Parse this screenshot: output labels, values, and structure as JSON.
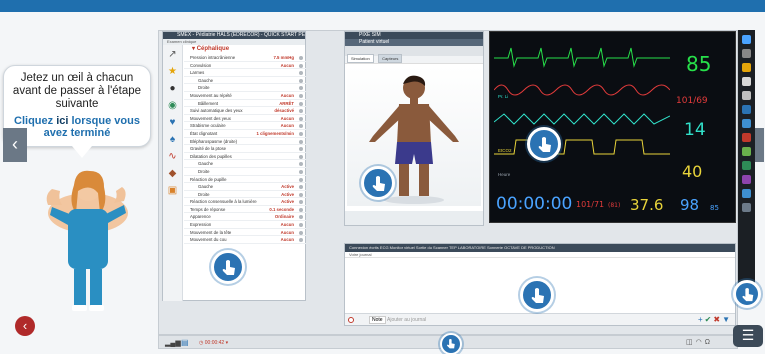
{
  "tutorial": {
    "line1": "Jetez un œil à chacun avant de passer à l'étape suivante",
    "cta_pre": "Cliquez ",
    "cta_link": "ici",
    "cta_post": " lorsque vous avez terminé"
  },
  "nav": {
    "prev": "‹",
    "next": "›",
    "exit": "‹"
  },
  "patient_list": {
    "header": "SMEX - Pédiatrie HALS (EDRECOR) - QUICK START PEDIA...",
    "subtabs": "Examen clinique",
    "section": "Céphalique",
    "rows": [
      {
        "label": "Pression intracrânienne",
        "value": "7.5 mmHg",
        "sub": false
      },
      {
        "label": "Convulsion",
        "value": "Aucun",
        "sub": false
      },
      {
        "label": "Larmes",
        "value": "",
        "sub": false
      },
      {
        "label": "Gauche",
        "value": "",
        "sub": true
      },
      {
        "label": "Droite",
        "value": "",
        "sub": true
      },
      {
        "label": "Mouvement au répété",
        "value": "Aucun",
        "sub": false
      },
      {
        "label": "Bâillement",
        "value": "ARRÊT",
        "sub": true
      },
      {
        "label": "Suivi automatique des yeux",
        "value": "désactivé",
        "sub": false
      },
      {
        "label": "Mouvement des yeux",
        "value": "Aucun",
        "sub": false
      },
      {
        "label": "Strabisme oculaire",
        "value": "Aucun",
        "sub": false
      },
      {
        "label": "État clignotant",
        "value": "1 clignements/min",
        "sub": false
      },
      {
        "label": "Blépharospasme (droite)",
        "value": "",
        "sub": false
      },
      {
        "label": "Gravité de la ptose",
        "value": "",
        "sub": false
      },
      {
        "label": "Dilatation des pupilles",
        "value": "",
        "sub": false
      },
      {
        "label": "Gauche",
        "value": "",
        "sub": true
      },
      {
        "label": "Droite",
        "value": "",
        "sub": true
      },
      {
        "label": "Réaction de pupille",
        "value": "",
        "sub": false
      },
      {
        "label": "Gauche",
        "value": "Active",
        "sub": true
      },
      {
        "label": "Droite",
        "value": "Active",
        "sub": true
      },
      {
        "label": "Réaction consensuelle à la lumière",
        "value": "Active",
        "sub": false
      },
      {
        "label": "Temps de réponse",
        "value": "0.1 seconde",
        "sub": false
      },
      {
        "label": "Apparence",
        "value": "Ordinaire",
        "sub": false
      },
      {
        "label": "Expression",
        "value": "Aucun",
        "sub": false
      },
      {
        "label": "Mouvement de la tête",
        "value": "Aucun",
        "sub": false
      },
      {
        "label": "Mouvement du cou",
        "value": "Aucun",
        "sub": false
      }
    ]
  },
  "patient_view": {
    "header": "PIXE SIM",
    "subheader": "Patient virtuel",
    "tabs": [
      "Simulation",
      "Capteurs"
    ]
  },
  "monitor": {
    "hr": "85",
    "bp": "101/69",
    "spo2": "14",
    "rr": "40",
    "etco2_label": "EtCO2",
    "pr_label": "Pr. Li",
    "timer_label": "Heure",
    "timer": "00:00:00",
    "nibp": "101/71",
    "map": "(81)",
    "temp": "37.6",
    "spo2b": "98",
    "spo2b_small": "85"
  },
  "journal": {
    "tabs": "Connexion écrits   ECG   Monitor virtuel   Sortie du   Scanner   TEP   LABORATOIRE   Sonnerie   OCTAVE DE PRODUCTION",
    "sub": "Votre journal",
    "add_label": "Note",
    "placeholder": "Ajouter au journal"
  },
  "status": {
    "clock": "◷ 00:00:42 ▾"
  },
  "menu": {
    "label": "☰"
  },
  "colors": {
    "ecg": "#27e04a",
    "pleth": "#e23b3b",
    "teal": "#31e0c9",
    "yellow": "#e8d33a",
    "hotspot": "#2b73b3"
  }
}
